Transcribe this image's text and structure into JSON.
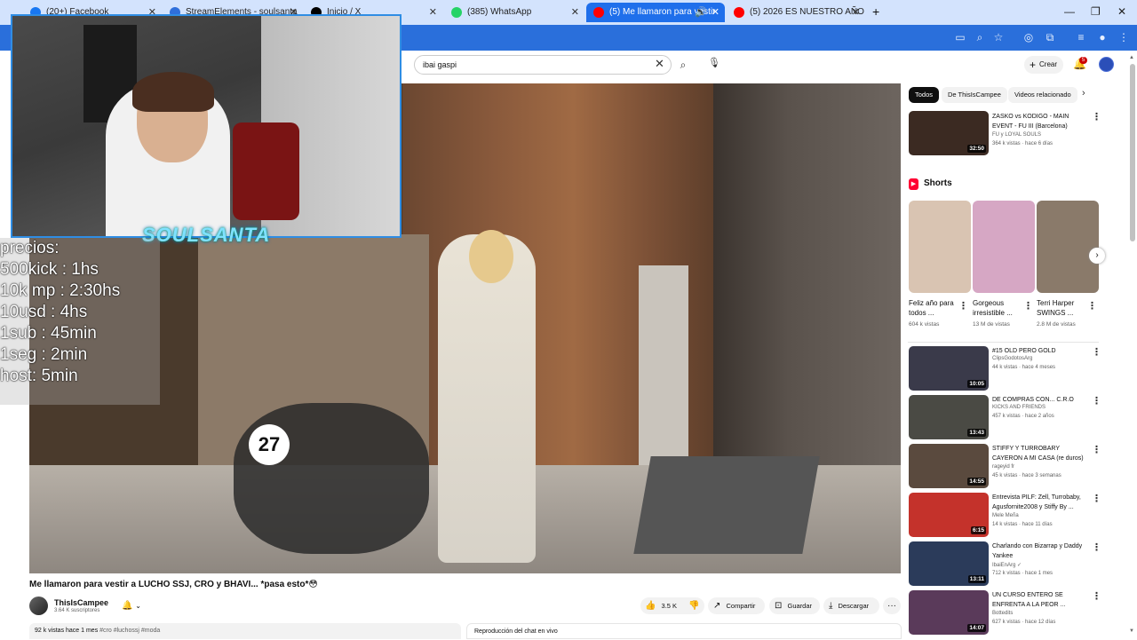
{
  "browser": {
    "tabs": [
      {
        "label": "(20+) Facebook",
        "favicon": "facebook-icon",
        "color": "#1877f2"
      },
      {
        "label": "StreamElements - soulsanta",
        "favicon": "streamelements-icon",
        "color": "#2f6fdb"
      },
      {
        "label": "Inicio / X",
        "favicon": "x-icon",
        "color": "#000000"
      },
      {
        "label": "(385) WhatsApp",
        "favicon": "whatsapp-icon",
        "color": "#25d366"
      },
      {
        "label": "(5) Me llamaron para vestir",
        "favicon": "youtube-icon",
        "color": "#ff0000"
      },
      {
        "label": "(5) 2026 ES NUESTRO AÑO ай",
        "favicon": "youtube-icon",
        "color": "#ff0000"
      }
    ],
    "new_tab": "+",
    "window_controls": [
      "—",
      "❐",
      "✕"
    ]
  },
  "youtube": {
    "search_value": "ibai gaspi",
    "create_label": "Crear",
    "notification_count": "5"
  },
  "stream_overlay": {
    "logo_text": "SOULSANTA",
    "price_lines": [
      "precios:",
      "500kick : 1hs",
      "10k mp : 2:30hs",
      "10usd : 4hs",
      "1sub : 45min",
      "1seg : 2min",
      "host: 5min"
    ]
  },
  "video": {
    "bike_number": "27",
    "title": "Me llamaron para vestir a LUCHO SSJ, CRO y BHAVI... *pasa esto*😳",
    "channel": "ThisIsCampee",
    "subscribers": "3.64 K suscriptores",
    "likes": "3.5 K",
    "share_label": "Compartir",
    "save_label": "Guardar",
    "download_label": "Descargar",
    "views_date": "92 k vistas  hace 1 mes",
    "tags": "#cro #luchossj #moda",
    "chat_replay": "Reproducción del chat en vivo"
  },
  "related": {
    "chips": [
      "Todos",
      "De ThisIsCampee",
      "Videos relacionado"
    ],
    "top_video": {
      "title": "ZASKO vs KODIGO - MAIN EVENT - FU III (Barcelona)",
      "channel": "FU y LOYAL SOULS",
      "meta": "364 k vistas · hace 6 días",
      "duration": "32:50",
      "color": "#3b2a22"
    },
    "shorts_label": "Shorts",
    "shorts": [
      {
        "title": "Feliz año para todos ...",
        "views": "604 k vistas",
        "color": "#d9c4b2"
      },
      {
        "title": "Gorgeous irresistible ...",
        "views": "13 M de vistas",
        "color": "#d6a7c4"
      },
      {
        "title": "Terri Harper SWINGS ...",
        "views": "2.8 M de vistas",
        "color": "#8a7a6a"
      }
    ],
    "videos": [
      {
        "title": "#15 OLD PERO GOLD",
        "channel": "ClipsGodotosArg",
        "meta": "44 k vistas · hace 4 meses",
        "duration": "10:05",
        "color": "#3a3a4a"
      },
      {
        "title": "DE COMPRAS CON... C.R.O",
        "channel": "KICKS AND FRIENDS",
        "meta": "457 k vistas · hace 2 años",
        "duration": "13:43",
        "color": "#4a4a44"
      },
      {
        "title": "STIFFY Y TURROBARY CAYERON A MI CASA (re duros)",
        "channel": "rageyid fr",
        "meta": "45 k vistas · hace 3 semanas",
        "duration": "14:55",
        "color": "#5a4a3e"
      },
      {
        "title": "Entrevista PILF: Zell, Turrobaby, Agusfornite2008 y Stiffy By ...",
        "channel": "Mele Meña",
        "meta": "14 k vistas · hace 11 días",
        "duration": "6:15",
        "color": "#c4322b"
      },
      {
        "title": "Charlando con Bizarrap y Daddy Yankee",
        "channel": "IbaiEnArg ✓",
        "meta": "712 k vistas · hace 1 mes",
        "duration": "13:11",
        "color": "#2b3b5a"
      },
      {
        "title": "UN CURSO ENTERO SE ENFRENTA A LA PEOR ...",
        "channel": "Bottedits",
        "meta": "627 k vistas · hace 12 días",
        "duration": "14:07",
        "color": "#5a3a5a"
      }
    ]
  }
}
